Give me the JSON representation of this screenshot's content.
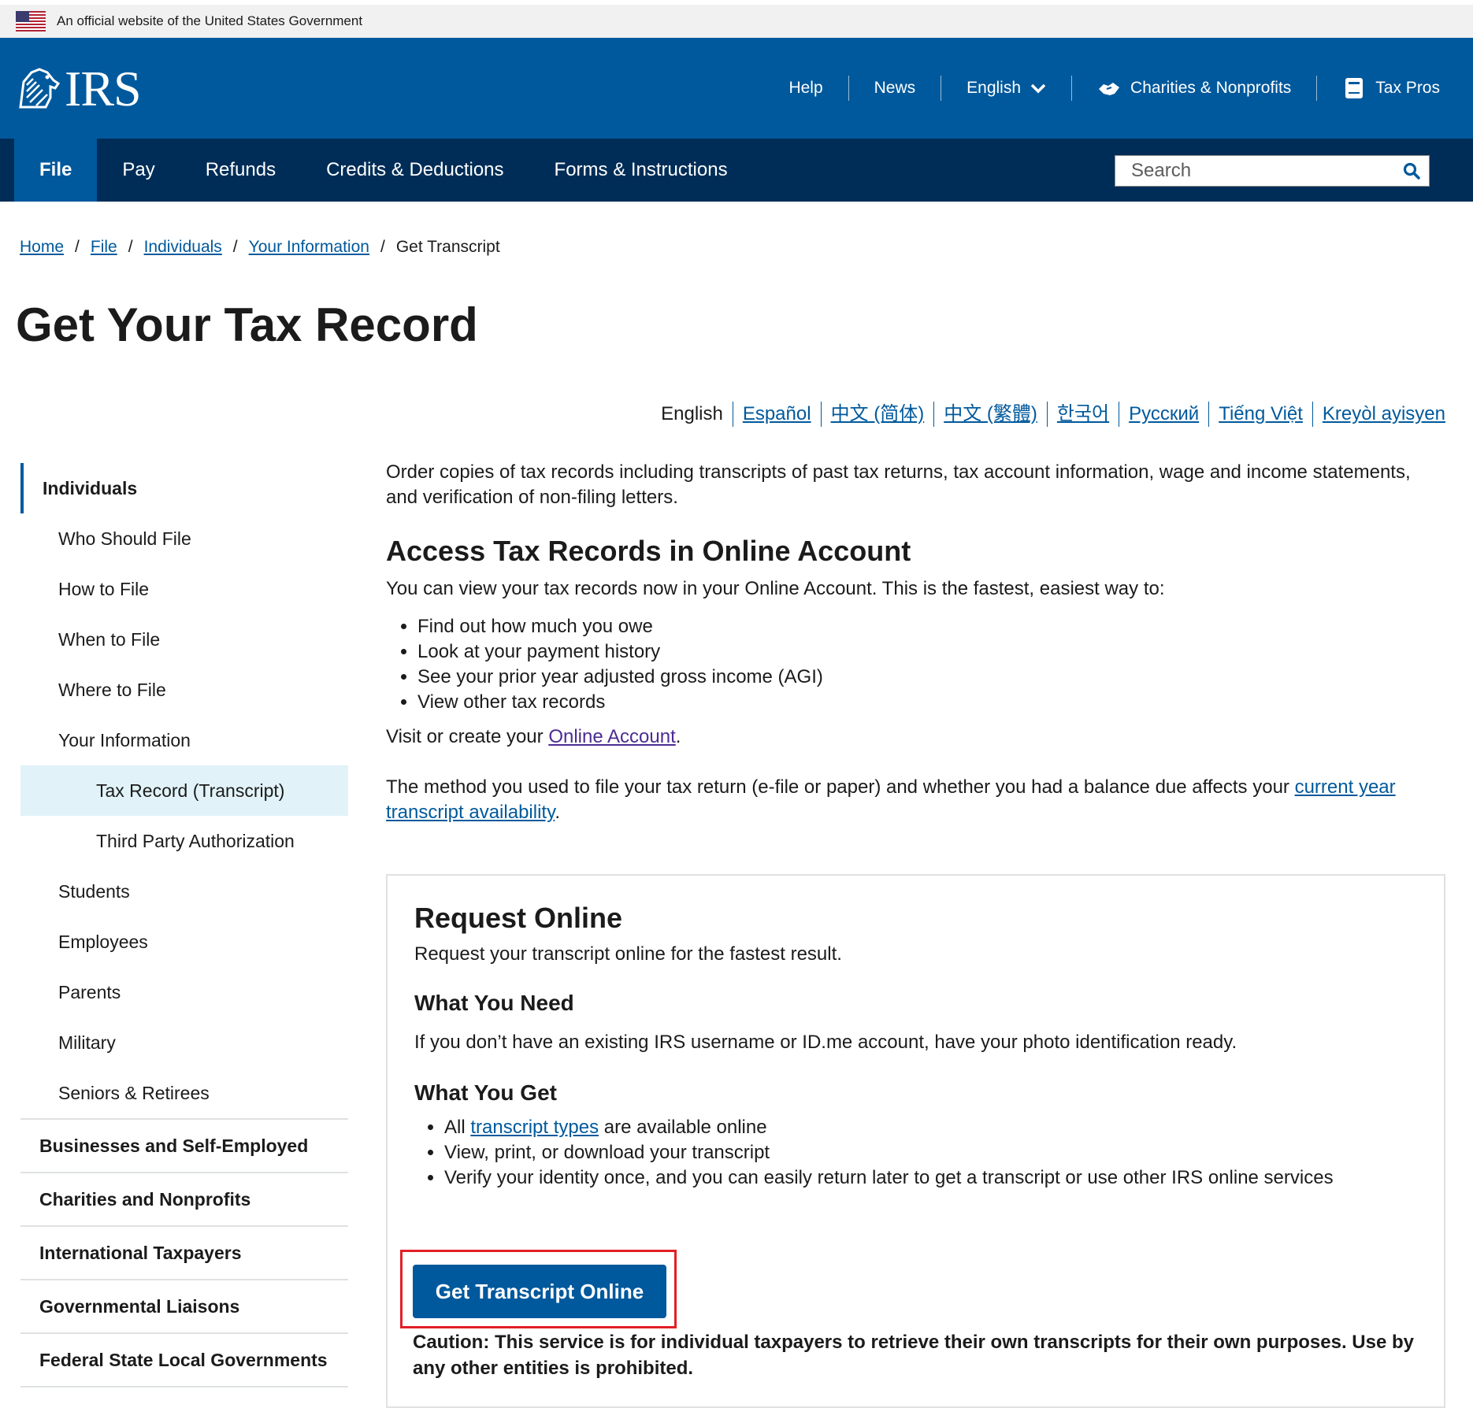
{
  "gov_banner": {
    "text": "An official website of the United States Government"
  },
  "header": {
    "logo_text": "IRS",
    "util_nav": {
      "help": "Help",
      "news": "News",
      "language": "English",
      "charities": "Charities & Nonprofits",
      "tax_pros": "Tax Pros"
    }
  },
  "main_nav": {
    "items": [
      "File",
      "Pay",
      "Refunds",
      "Credits & Deductions",
      "Forms & Instructions"
    ],
    "search_placeholder": "Search"
  },
  "breadcrumb": {
    "items": [
      "Home",
      "File",
      "Individuals",
      "Your Information"
    ],
    "current": "Get Transcript"
  },
  "page_title": "Get Your Tax Record",
  "languages": {
    "current": "English",
    "links": [
      "Español",
      "中文 (简体)",
      "中文 (繁體)",
      "한국어",
      "Русский",
      "Tiếng Việt",
      "Kreyòl ayisyen"
    ]
  },
  "sidebar": {
    "parent": "Individuals",
    "children": [
      "Who Should File",
      "How to File",
      "When to File",
      "Where to File",
      "Your Information"
    ],
    "grandchildren": [
      "Tax Record (Transcript)",
      "Third Party Authorization"
    ],
    "children_after": [
      "Students",
      "Employees",
      "Parents",
      "Military",
      "Seniors & Retirees"
    ],
    "sections": [
      "Businesses and Self-Employed",
      "Charities and Nonprofits",
      "International Taxpayers",
      "Governmental Liaisons",
      "Federal State Local Governments"
    ]
  },
  "content": {
    "intro": "Order copies of tax records including transcripts of past tax returns, tax account information, wage and income statements, and verification of non-filing letters.",
    "online_heading": "Access Tax Records in Online Account",
    "online_lead": "You can view your tax records now in your Online Account. This is the fastest, easiest way to:",
    "online_bullets": [
      "Find out how much you owe",
      "Look at your payment history",
      "See your prior year adjusted gross income (AGI)",
      "View other tax records"
    ],
    "visit_prefix": "Visit or create your ",
    "visit_link": "Online Account",
    "visit_suffix": ".",
    "method_text": "The method you used to file your tax return (e-file or paper) and whether you had a balance due affects  your ",
    "method_link": "current year transcript availability",
    "method_suffix": "."
  },
  "card": {
    "title": "Request Online",
    "lead": "Request your transcript online for the fastest result.",
    "need_heading": "What You Need",
    "need_text": "If you don’t have an existing IRS username or ID.me account, have your photo identification ready.",
    "get_heading": "What You Get",
    "get_b1_prefix": "All ",
    "get_b1_link": "transcript types",
    "get_b1_suffix": " are available online",
    "get_b2": "View, print, or download your transcript",
    "get_b3": "Verify your identity once, and you can easily return later to get a transcript or use other IRS online services",
    "button": "Get Transcript Online",
    "caution": "Caution: This service is for individual taxpayers to retrieve their own transcripts for their own purposes. Use by any other entities is prohibited."
  },
  "colors": {
    "primary_blue": "#00599c",
    "dark_navy": "#002d57",
    "active_side_bg": "#e1f3f8",
    "highlight_red": "#e21f26"
  }
}
